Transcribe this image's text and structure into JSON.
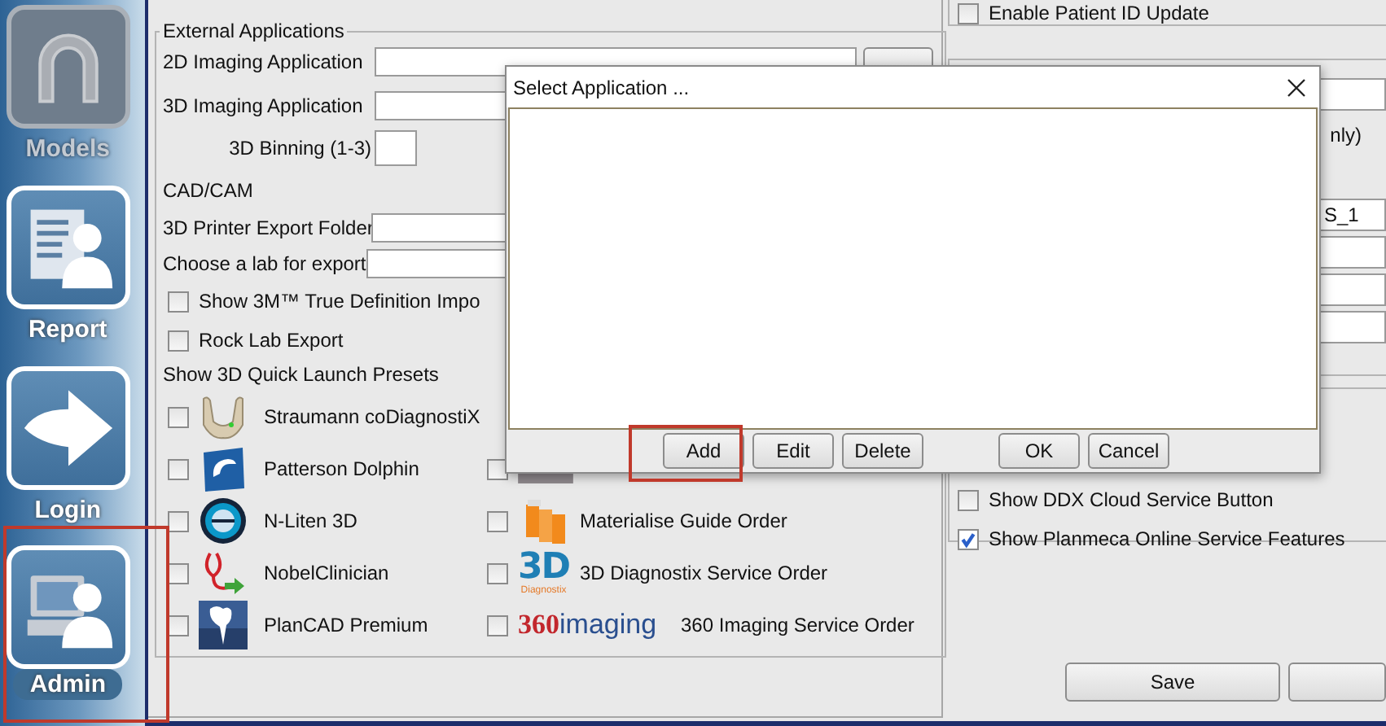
{
  "sidebar": {
    "items": [
      {
        "label": "Models",
        "kind": "arch",
        "disabled": true,
        "selected": false,
        "highlighted": false
      },
      {
        "label": "Report",
        "kind": "report",
        "disabled": false,
        "selected": false,
        "highlighted": false
      },
      {
        "label": "Login",
        "kind": "arrow",
        "disabled": false,
        "selected": false,
        "highlighted": false
      },
      {
        "label": "Admin",
        "kind": "admin",
        "disabled": false,
        "selected": true,
        "highlighted": true
      }
    ]
  },
  "external_applications": {
    "title": "External Applications",
    "imaging_2d": {
      "label": "2D Imaging Application"
    },
    "imaging_3d": {
      "label": "3D Imaging Application"
    },
    "binning": {
      "label": "3D Binning (1-3)"
    },
    "cad_cam_heading": "CAD/CAM",
    "printer_export": {
      "label": "3D Printer Export Folder"
    },
    "lab_export": {
      "label": "Choose a lab for export"
    },
    "options": [
      {
        "label": "Show 3M™ True Definition Impo",
        "checked": false
      },
      {
        "label": "Rock Lab Export",
        "checked": false
      }
    ],
    "presets_heading": "Show 3D Quick Launch Presets",
    "presets_left": [
      {
        "kind": "jaw",
        "label": "Straumann coDiagnostiX",
        "checked": false
      },
      {
        "kind": "dolphin",
        "label": "Patterson Dolphin",
        "checked": false
      },
      {
        "kind": "globe",
        "label": "N-Liten 3D",
        "checked": false
      },
      {
        "kind": "stethoscope",
        "label": "NobelClinician",
        "checked": false
      },
      {
        "kind": "tooth",
        "label": "PlanCAD Premium",
        "checked": false
      }
    ],
    "presets_right": [
      {
        "kind": "machine",
        "checked": false
      },
      {
        "kind": "blocks",
        "label": "Materialise Guide Order",
        "checked": false
      },
      {
        "kind": "logo3d",
        "logo": "3D",
        "logo_caption": "Diagnostix",
        "label": "3D Diagnostix Service Order",
        "checked": false
      },
      {
        "kind": "logo360",
        "logo": "360",
        "logo_caption": "imaging",
        "label": "360 Imaging Service Order",
        "checked": false
      }
    ]
  },
  "patient_id": {
    "label": "Enable Patient ID Update",
    "checked": false
  },
  "recording": {
    "partial_label": "nly)",
    "field_value": "S_1"
  },
  "service_options": [
    {
      "label": "Show DDX Cloud Service Button",
      "checked": false
    },
    {
      "label": "Show Planmeca Online Service Features",
      "checked": true
    }
  ],
  "footer_buttons": [
    "Save"
  ],
  "dialog": {
    "title": "Select Application ...",
    "list_buttons": [
      {
        "label": "Add",
        "highlighted": true
      },
      {
        "label": "Edit",
        "highlighted": false
      },
      {
        "label": "Delete",
        "highlighted": false
      }
    ],
    "dialog_buttons": [
      {
        "label": "OK",
        "highlighted": false
      },
      {
        "label": "Cancel",
        "highlighted": false
      }
    ]
  }
}
